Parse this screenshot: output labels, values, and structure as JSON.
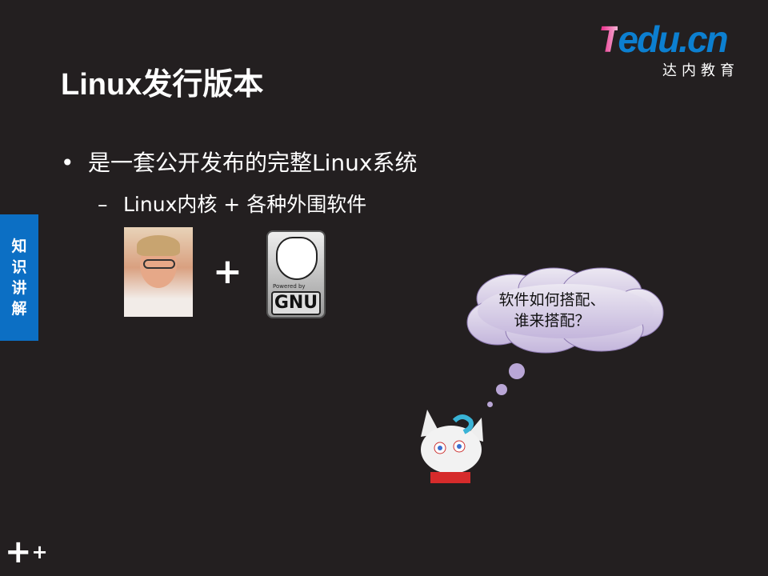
{
  "logo": {
    "brand": "Tedu.cn",
    "brand_first": "T",
    "brand_rest": "edu.cn",
    "subtitle": "达内教育",
    "colors": {
      "pink": "#e6197f",
      "blue": "#0c7fd0"
    }
  },
  "slide": {
    "title": "Linux发行版本",
    "bullet": "是一套公开发布的完整Linux系统",
    "sub_bullet": "Linux内核 + 各种外围软件",
    "plus": "+",
    "gnu_powered": "Powered by",
    "gnu_label": "GNU"
  },
  "side_tab": {
    "chars": [
      "知",
      "识",
      "讲",
      "解"
    ],
    "color": "#0c6fc4"
  },
  "thought": {
    "line1": "软件如何搭配、",
    "line2": "谁来搭配？"
  },
  "background": "#231f20"
}
